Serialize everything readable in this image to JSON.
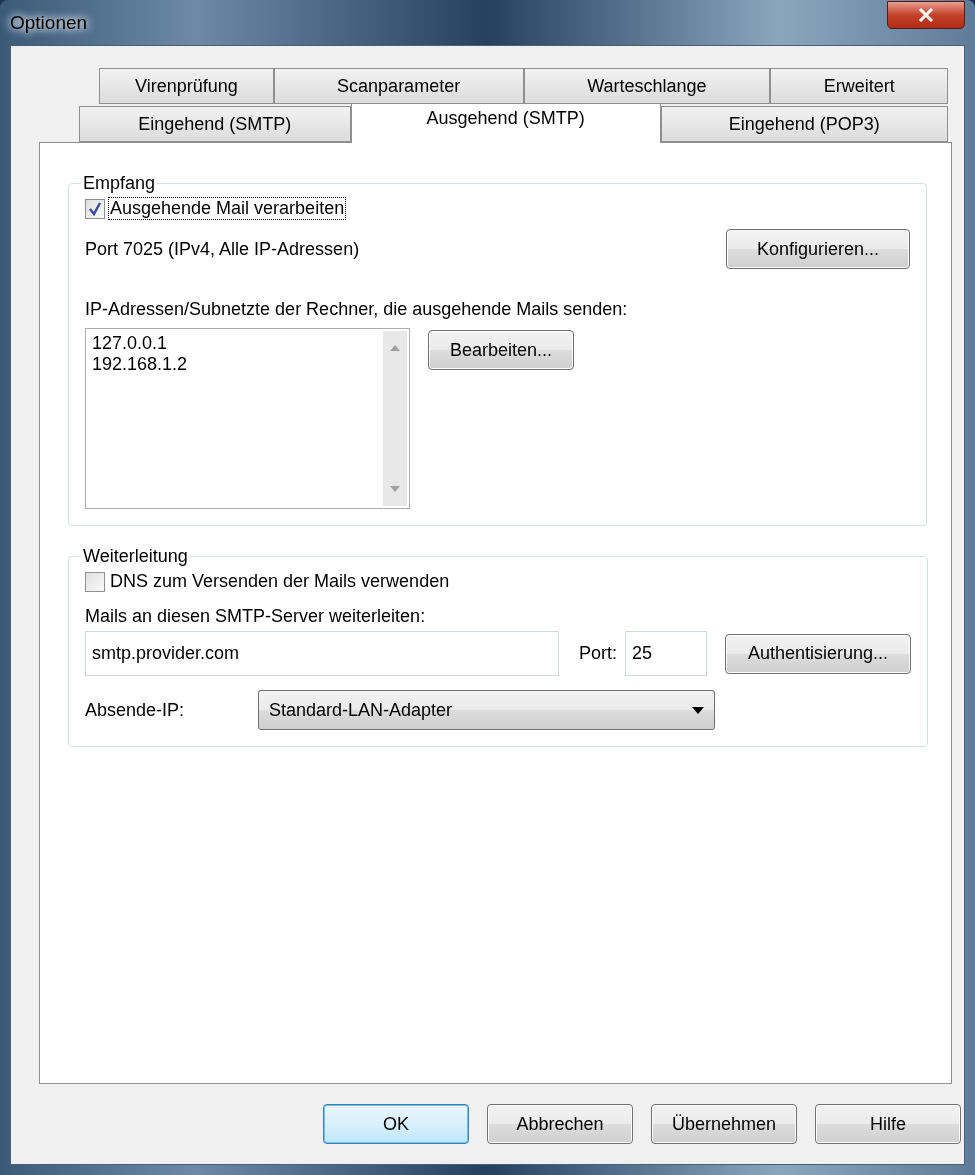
{
  "window": {
    "title": "Optionen"
  },
  "tab_rows": [
    [
      {
        "label": "Virenprüfung",
        "selected": false
      },
      {
        "label": "Scanparameter",
        "selected": false
      },
      {
        "label": "Warteschlange",
        "selected": false
      },
      {
        "label": "Erweitert",
        "selected": false
      }
    ],
    [
      {
        "label": "Eingehend (SMTP)",
        "selected": false
      },
      {
        "label": "Ausgehend (SMTP)",
        "selected": true
      },
      {
        "label": "Eingehend (POP3)",
        "selected": false
      }
    ]
  ],
  "receive": {
    "title": "Empfang",
    "checkbox": {
      "label": "Ausgehende Mail verarbeiten",
      "checked": true
    },
    "port_text": "Port 7025 (IPv4, Alle IP-Adressen)",
    "configure_button": "Konfigurieren...",
    "list_label": "IP-Adressen/Subnetzte der Rechner, die ausgehende Mails senden:",
    "list_items": [
      "127.0.0.1",
      "192.168.1.2"
    ],
    "edit_button": "Bearbeiten..."
  },
  "forwarding": {
    "title": "Weiterleitung",
    "checkbox": {
      "label": "DNS zum Versenden der Mails verwenden",
      "checked": false
    },
    "server_label": "Mails an diesen SMTP-Server weiterleiten:",
    "server_value": "smtp.provider.com",
    "port_label": "Port:",
    "port_value": "25",
    "auth_button": "Authentisierung...",
    "sender_label": "Absende-IP:",
    "sender_value": "Standard-LAN-Adapter"
  },
  "buttons": [
    {
      "label": "OK",
      "default": true
    },
    {
      "label": "Abbrechen",
      "default": false
    },
    {
      "label": "Übernehmen",
      "default": false
    },
    {
      "label": "Hilfe",
      "default": false
    }
  ]
}
